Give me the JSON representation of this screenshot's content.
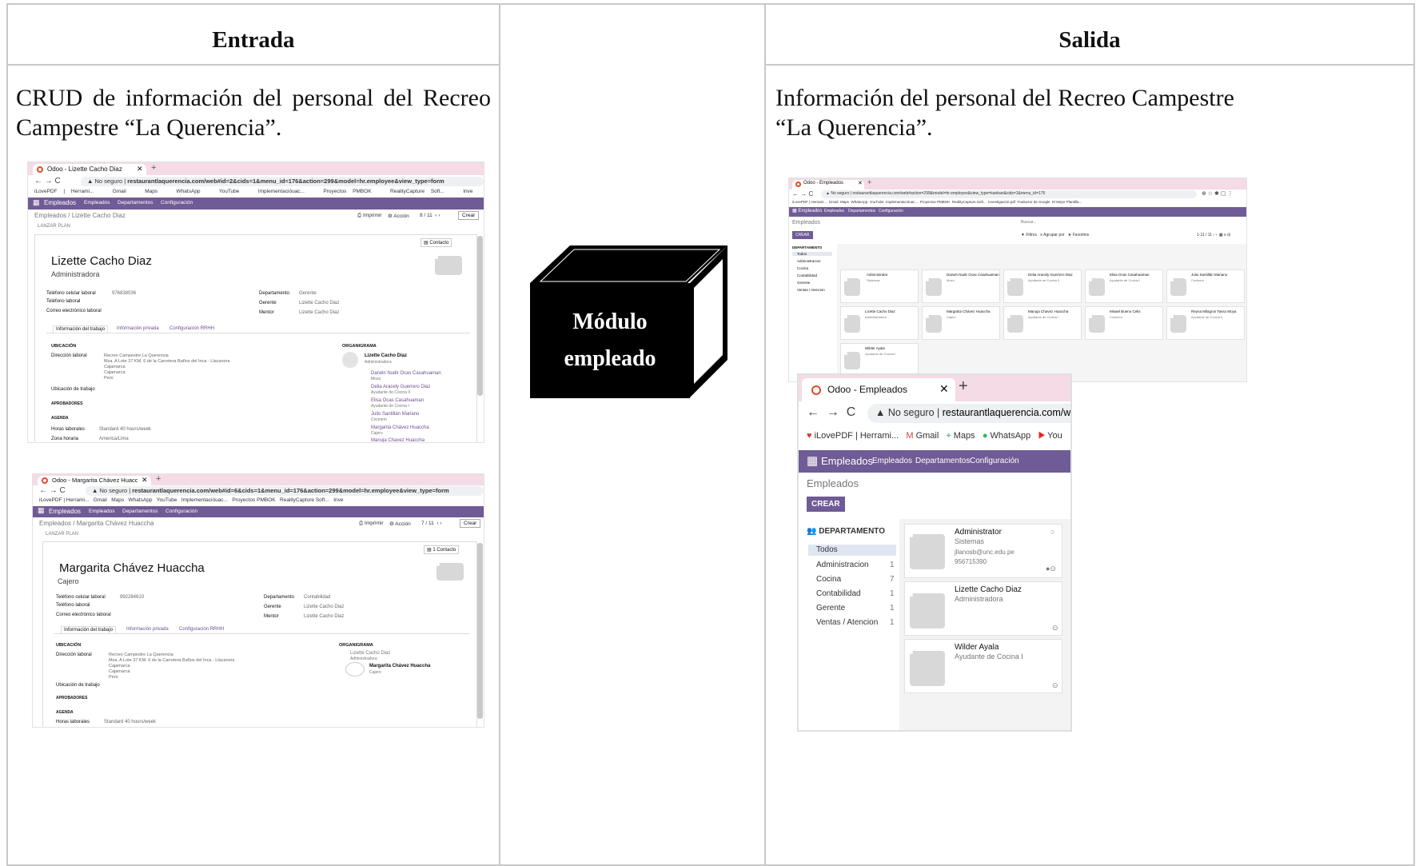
{
  "table": {
    "left_header": "Entrada",
    "right_header": "Salida",
    "left_desc": "CRUD de información del personal del Recreo Campestre “La Querencia”.",
    "right_desc": "Información del personal del Recreo Campestre “La Querencia”.",
    "module_label_1": "Módulo",
    "module_label_2": "empleado"
  },
  "shot1": {
    "tab_title": "Odoo - Lizette Cacho Diaz",
    "url_prefix": "No seguro",
    "url": "restaurantlaquerencia.com/web#id=2&cids=1&menu_id=176&action=299&model=hr.employee&view_type=form",
    "bookmarks": [
      "iLovePDF | Herrami...",
      "Gmail",
      "Maps",
      "WhatsApp",
      "YouTube",
      "Implementacióuac...",
      "Proyectos PMBOK",
      "RealityCapture Soft...",
      "Inve"
    ],
    "nav": [
      "Empleados",
      "Empleados",
      "Departamentos",
      "Configuración"
    ],
    "breadcrumb": "Empleados / Lizette Cacho Diaz",
    "actions": [
      "Imprimir",
      "Acción",
      "8 / 11",
      "Crear"
    ],
    "launch_plan": "LANZAR PLAN",
    "contact_btn": "Contacto",
    "name": "Lizette Cacho Diaz",
    "job": "Administradora",
    "fields_left": [
      [
        "Teléfono celular laboral",
        "976838036"
      ],
      [
        "Teléfono laboral",
        ""
      ],
      [
        "Correo electrónico laboral",
        ""
      ]
    ],
    "fields_right": [
      [
        "Departamento",
        "Gerente"
      ],
      [
        "Gerente",
        "Lizette Cacho Diaz"
      ],
      [
        "Mentor",
        "Lizette Cacho Diaz"
      ]
    ],
    "tabs": [
      "Información del trabajo",
      "Información privada",
      "Configuración RRHH"
    ],
    "ubicacion": "UBICACIÓN",
    "dir_label": "Dirección laboral",
    "dir_value": [
      "Recreo Campestre La Querencia",
      "Mza. A Lote 37 KM. 6 de la Carretera Baños del Inca - Llacanora",
      "Cajamarca",
      "Cajamarca",
      "Perú"
    ],
    "work_loc": "Ubicación de trabajo",
    "aprob": "APROBADORES",
    "agenda": "AGENDA",
    "horas_label": "Horas laborales",
    "horas_value": "Standard 40 hours/week",
    "zona_label": "Zona horaria",
    "zona_value": "America/Lima",
    "org_title": "ORGANIGRAMA",
    "org": [
      [
        "Lizette Cacho Diaz",
        "Administradora"
      ],
      [
        "Darwin Nudir Ocas Casahuaman",
        "Mozo"
      ],
      [
        "Delia Aracely Guerrero Diaz",
        "Ayudante de Cocina II"
      ],
      [
        "Elisa Ocas Casahuaman",
        "Ayudante de Cocina I"
      ],
      [
        "Julio Santillán Mariano",
        "Cocinero"
      ],
      [
        "Margarita Chávez Huaccha",
        "Cajero"
      ],
      [
        "Manuja Chavez Huaccha",
        "Ayudante de Cocina I"
      ]
    ]
  },
  "shot2": {
    "tab_title": "Odoo - Margarita Chávez Huacc",
    "url_prefix": "No seguro",
    "url": "restaurantlaquerencia.com/web#id=6&cids=1&menu_id=176&action=299&model=hr.employee&view_type=form",
    "breadcrumb": "Empleados / Margarita Chávez Huaccha",
    "actions": [
      "Imprimir",
      "Acción",
      "7 / 11",
      "Crear"
    ],
    "launch_plan": "LANZAR PLAN",
    "contact_btn": "1 Contacto",
    "name": "Margarita Chávez Huaccha",
    "job": "Cajero",
    "fields_left": [
      [
        "Teléfono celular laboral",
        "992284610"
      ],
      [
        "Teléfono laboral",
        ""
      ],
      [
        "Correo electrónico laboral",
        ""
      ]
    ],
    "fields_right": [
      [
        "Departamento",
        "Contabilidad"
      ],
      [
        "Gerente",
        "Lizette Cacho Diaz"
      ],
      [
        "Mentor",
        "Lizette Cacho Diaz"
      ]
    ],
    "tabs": [
      "Información del trabajo",
      "Información privada",
      "Configuración RRHH"
    ],
    "org": [
      [
        "Lizette Cacho Diaz",
        "Administradora"
      ],
      [
        "Margarita Chávez Huaccha",
        "Cajero"
      ]
    ],
    "dir_value": [
      "Recreo Campestre La Querencia",
      "Mza. A Lote 37 KM. 6 de la Carretera Baños del Inca - Llacanora",
      "Cajamarca",
      "Cajamarca",
      "Perú"
    ],
    "horas_value": "Standard 40 hours/week"
  },
  "shot3": {
    "tab_title": "Odoo - Empleados",
    "url": "restaurantlaquerencia.com/web#action=299&model=hr.employee&view_type=kanban&cids=1&menu_id=176",
    "bookmarks": [
      "iLovePDF | Herrami...",
      "Gmail",
      "Maps",
      "WhatsApp",
      "YouTube",
      "Implementacióuac...",
      "Proyectos PMBOK",
      "RealityCapture Soft...",
      "Investigación.pdf",
      "Traductor de Google",
      "El Mejor Plantilla..."
    ],
    "search_hint": "Buscar...",
    "filters": [
      "Filtros",
      "Agrupar por",
      "Favoritos"
    ],
    "pager": "1-11 / 11",
    "dept_list": [
      [
        "Todos",
        ""
      ],
      [
        "Administracion",
        "1"
      ],
      [
        "Cocina",
        "7"
      ],
      [
        "Contabilidad",
        "1"
      ],
      [
        "Gerente",
        "1"
      ],
      [
        "Ventas / Atencion",
        "1"
      ]
    ],
    "cards": [
      [
        "Administrator",
        "Sistemas"
      ],
      [
        "Darwin Nudir Ocas Casahuaman",
        "Mozo"
      ],
      [
        "Delia Aracely Guerrero Diaz",
        "Ayudante de Cocina II"
      ],
      [
        "Elisa Ocas Casahuaman",
        "Ayudante de Cocina I"
      ],
      [
        "Julio Santillán Mariano",
        "Cocinero"
      ],
      [
        "Lizette Cacho Diaz",
        "Administradora"
      ],
      [
        "Margarita Chávez Huaccha",
        "Cajero"
      ],
      [
        "Manuja Chavez Huaccha",
        "Ayudante de Cocina I"
      ],
      [
        "Misael Bueno Celis",
        "Cocinero"
      ],
      [
        "Reyna Milagros Tasso Moya",
        "Ayudante de Cocina II"
      ],
      [
        "Wilder Ayala",
        "Ayudante de Cocina I"
      ]
    ]
  },
  "shot4": {
    "tab_title": "Odoo - Empleados",
    "url_prefix": "No seguro",
    "url": "restaurantlaquerencia.com/web#act",
    "bookmarks": [
      "iLovePDF | Herrami...",
      "Gmail",
      "Maps",
      "WhatsApp",
      "You"
    ],
    "nav": [
      "Empleados",
      "Empleados",
      "Departamentos",
      "Configuración"
    ],
    "page_title": "Empleados",
    "create": "CREAR",
    "dept_header": "DEPARTAMENTO",
    "dept_list": [
      [
        "Todos",
        ""
      ],
      [
        "Administracion",
        "1"
      ],
      [
        "Cocina",
        "7"
      ],
      [
        "Contabilidad",
        "1"
      ],
      [
        "Gerente",
        "1"
      ],
      [
        "Ventas / Atencion",
        "1"
      ]
    ],
    "cards": [
      {
        "name": "Administrator",
        "job": "Sistemas",
        "email": "jllanosb@unc.edu.pe",
        "phone": "956715390"
      },
      {
        "name": "Lizette Cacho Diaz",
        "job": "Administradora",
        "email": "",
        "phone": ""
      },
      {
        "name": "Wilder Ayala",
        "job": "Ayudante de Cocina I",
        "email": "",
        "phone": ""
      }
    ]
  },
  "colors": {
    "odoo_purple": "#6f5b95",
    "tab_pink": "#f4dbe6",
    "border": "#c8c8c8"
  }
}
